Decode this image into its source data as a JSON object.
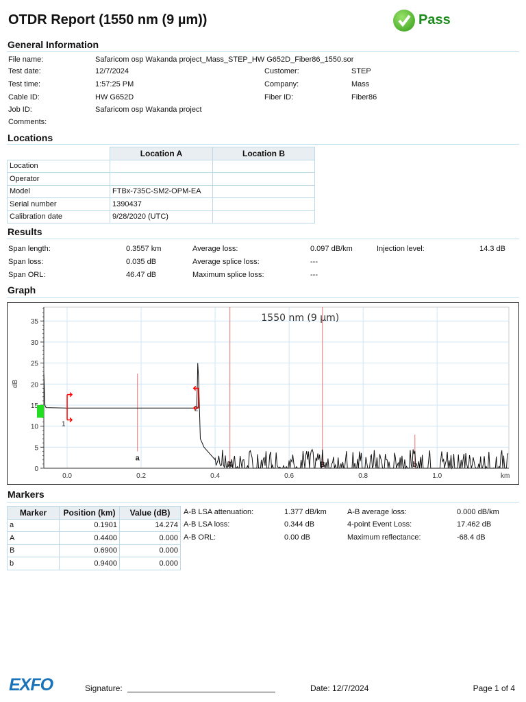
{
  "header": {
    "title": "OTDR Report (1550 nm (9 µm))",
    "status": "Pass",
    "status_color": "#1d8a1d"
  },
  "general": {
    "heading": "General Information",
    "file_name_label": "File name:",
    "file_name": "Safaricom osp Wakanda project_Mass_STEP_HW G652D_Fiber86_1550.sor",
    "test_date_label": "Test date:",
    "test_date": "12/7/2024",
    "test_time_label": "Test time:",
    "test_time": "1:57:25 PM",
    "cable_id_label": "Cable ID:",
    "cable_id": "HW G652D",
    "job_id_label": "Job ID:",
    "job_id": "Safaricom osp Wakanda project",
    "comments_label": "Comments:",
    "customer_label": "Customer:",
    "customer": "STEP",
    "company_label": "Company:",
    "company": "Mass",
    "fiber_id_label": "Fiber ID:",
    "fiber_id": "Fiber86"
  },
  "locations": {
    "heading": "Locations",
    "col_a": "Location A",
    "col_b": "Location B",
    "rows": [
      {
        "label": "Location",
        "a": "",
        "b": ""
      },
      {
        "label": "Operator",
        "a": "",
        "b": ""
      },
      {
        "label": "Model",
        "a": "FTBx-735C-SM2-OPM-EA",
        "b": ""
      },
      {
        "label": "Serial number",
        "a": "1390437",
        "b": ""
      },
      {
        "label": "Calibration date",
        "a": "9/28/2020 (UTC)",
        "b": ""
      }
    ]
  },
  "results": {
    "heading": "Results",
    "span_length_label": "Span length:",
    "span_length": "0.3557 km",
    "span_loss_label": "Span loss:",
    "span_loss": "0.035 dB",
    "span_orl_label": "Span ORL:",
    "span_orl": "46.47 dB",
    "avg_loss_label": "Average loss:",
    "avg_loss": "0.097 dB/km",
    "avg_splice_label": "Average splice loss:",
    "avg_splice": "---",
    "max_splice_label": "Maximum splice loss:",
    "max_splice": "---",
    "injection_label": "Injection level:",
    "injection": "14.3 dB"
  },
  "graph": {
    "heading": "Graph"
  },
  "chart_data": {
    "type": "line",
    "title": "1550 nm (9 µm)",
    "xlabel": "km",
    "ylabel": "dB",
    "xlim": [
      -0.063,
      1.194
    ],
    "ylim": [
      0,
      38.3
    ],
    "xticks": [
      "0.0",
      "0.2",
      "0.4",
      "0.6",
      "0.8",
      "1.0"
    ],
    "yticks": [
      "0",
      "5",
      "10",
      "15",
      "20",
      "25",
      "30",
      "35"
    ],
    "grid": true,
    "trace": {
      "x": [
        -0.063,
        -0.06,
        -0.057,
        0.0,
        0.1,
        0.2,
        0.3,
        0.35,
        0.352,
        0.353,
        0.355,
        0.36,
        0.37,
        0.4
      ],
      "y": [
        22.5,
        15,
        14.4,
        14.3,
        14.3,
        14.3,
        14.3,
        14.3,
        20,
        25,
        22,
        7,
        5,
        2
      ]
    },
    "noise_floor_db": [
      0,
      4.5
    ],
    "markers": [
      {
        "label": "a",
        "x": 0.1901,
        "y0": 4,
        "y1": 22.5
      },
      {
        "label": "A",
        "x": 0.44,
        "y0": 0,
        "y1": 38.3
      },
      {
        "label": "B",
        "x": 0.69,
        "y0": 0,
        "y1": 38.3
      },
      {
        "label": "b",
        "x": 0.94,
        "y0": 0,
        "y1": 8
      }
    ],
    "events": [
      {
        "label": "1",
        "x": 0.0
      },
      {
        "label": "2",
        "x": 0.355
      }
    ],
    "launch_level": [
      12,
      15
    ]
  },
  "markers": {
    "heading": "Markers",
    "cols": [
      "Marker",
      "Position (km)",
      "Value (dB)"
    ],
    "rows": [
      {
        "m": "a",
        "pos": "0.1901",
        "val": "14.274"
      },
      {
        "m": "A",
        "pos": "0.4400",
        "val": "0.000"
      },
      {
        "m": "B",
        "pos": "0.6900",
        "val": "0.000"
      },
      {
        "m": "b",
        "pos": "0.9400",
        "val": "0.000"
      }
    ],
    "lsa_att_label": "A-B LSA attenuation:",
    "lsa_att": "1.377 dB/km",
    "lsa_loss_label": "A-B LSA loss:",
    "lsa_loss": "0.344 dB",
    "orl_label": "A-B ORL:",
    "orl": "0.00 dB",
    "avg_loss_label": "A-B average loss:",
    "avg_loss": "0.000 dB/km",
    "event_loss_label": "4-point Event Loss:",
    "event_loss": "17.462 dB",
    "max_refl_label": "Maximum reflectance:",
    "max_refl": "-68.4 dB"
  },
  "footer": {
    "logo": "EXFO",
    "signature_label": "Signature:",
    "date": "Date: 12/7/2024",
    "page": "Page 1 of 4"
  }
}
